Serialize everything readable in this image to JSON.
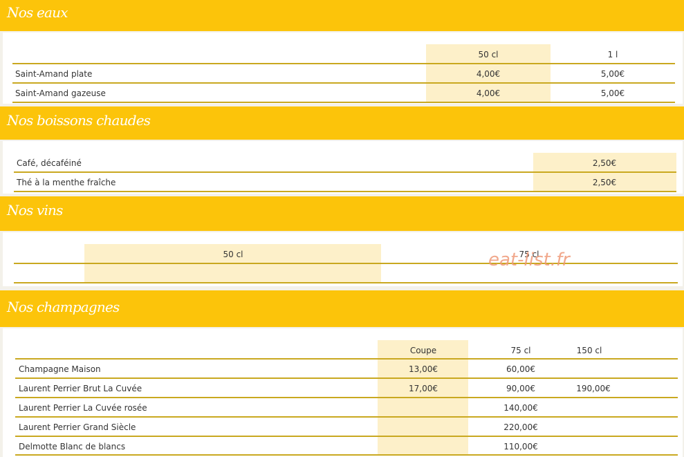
{
  "sections": {
    "eaux": {
      "title": "Nos eaux",
      "columns": [
        "50 cl",
        "1 l"
      ],
      "rows": [
        {
          "name": "Saint-Amand plate",
          "prices": [
            "4,00€",
            "5,00€"
          ]
        },
        {
          "name": "Saint-Amand gazeuse",
          "prices": [
            "4,00€",
            "5,00€"
          ]
        }
      ]
    },
    "boissons_chaudes": {
      "title": "Nos boissons chaudes",
      "rows": [
        {
          "name": "Café, décaféiné",
          "price": "2,50€"
        },
        {
          "name": "Thé à la menthe fraîche",
          "price": "2,50€"
        }
      ]
    },
    "vins": {
      "title": "Nos vins",
      "columns": [
        "50 cl",
        "75 cl"
      ]
    },
    "champagnes": {
      "title": "Nos champagnes",
      "columns": [
        "Coupe",
        "75 cl",
        "150 cl"
      ],
      "rows": [
        {
          "name": "Champagne Maison",
          "prices": [
            "13,00€",
            "60,00€",
            ""
          ]
        },
        {
          "name": "Laurent Perrier Brut La Cuvée",
          "prices": [
            "17,00€",
            "90,00€",
            "190,00€"
          ]
        },
        {
          "name": "Laurent Perrier La Cuvée rosée",
          "prices": [
            "",
            "140,00€",
            ""
          ]
        },
        {
          "name": "Laurent Perrier Grand Siècle",
          "prices": [
            "",
            "220,00€",
            ""
          ]
        },
        {
          "name": "Delmotte Blanc de blancs",
          "prices": [
            "",
            "110,00€",
            ""
          ]
        }
      ]
    }
  },
  "watermark": "eat-list.fr",
  "colors": {
    "band": "#fcc40a",
    "shade": "#fdf0c9",
    "rule": "#c9a81f",
    "watermark": "#ef9a78"
  }
}
